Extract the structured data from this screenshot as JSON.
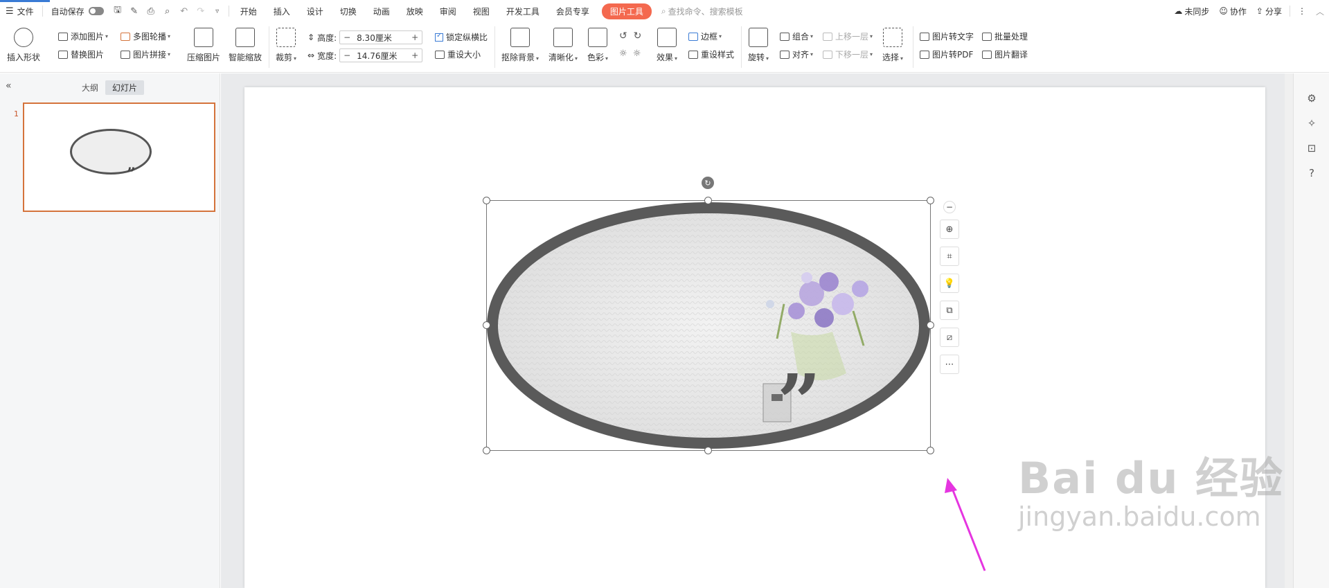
{
  "topbar": {
    "menu_label": "文件",
    "autosave_label": "自动保存",
    "tabs": [
      "开始",
      "插入",
      "设计",
      "切换",
      "动画",
      "放映",
      "审阅",
      "视图",
      "开发工具",
      "会员专享"
    ],
    "active_tab": "图片工具",
    "search_placeholder": "查找命令、搜索模板",
    "sync_label": "未同步",
    "collab_label": "协作",
    "share_label": "分享"
  },
  "ribbon": {
    "insert_shape": "插入形状",
    "add_picture": "添加图片",
    "replace_picture": "替换图片",
    "multi_carousel": "多图轮播",
    "picture_mosaic": "图片拼接",
    "compress_picture": "压缩图片",
    "smart_scale": "智能缩放",
    "crop": "裁剪",
    "height_label": "高度:",
    "height_value": "8.30厘米",
    "width_label": "宽度:",
    "width_value": "14.76厘米",
    "lock_ratio": "锁定纵横比",
    "reset_size": "重设大小",
    "remove_bg": "抠除背景",
    "sharpen": "清晰化",
    "color": "色彩",
    "effects": "效果",
    "border": "边框",
    "reset_style": "重设样式",
    "rotate": "旋转",
    "group": "组合",
    "align": "对齐",
    "bring_forward": "上移一层",
    "send_backward": "下移一层",
    "select": "选择",
    "pic_to_text": "图片转文字",
    "batch_process": "批量处理",
    "pic_to_pdf": "图片转PDF",
    "pic_translate": "图片翻译"
  },
  "leftpanel": {
    "outline_tab": "大纲",
    "slides_tab": "幻灯片",
    "slide_number": "1"
  },
  "watermark": {
    "line1": "Bai du 经验",
    "line2": "jingyan.baidu.com"
  },
  "colors": {
    "accent": "#f4694f",
    "selection_thumb": "#d4733b",
    "arrow": "#e535e0",
    "ellipse_border": "#5a5a5a"
  },
  "icons": [
    "menu-icon",
    "toggle-icon",
    "save-icon",
    "print-icon",
    "undo-icon",
    "redo-icon",
    "search-icon",
    "cloud-icon",
    "user-icon",
    "share-icon",
    "more-icon",
    "zoom-in-icon",
    "crop-icon",
    "bulb-icon",
    "copy-icon",
    "eraser-icon",
    "ellipsis-icon",
    "rotate-icon",
    "minus-icon"
  ]
}
